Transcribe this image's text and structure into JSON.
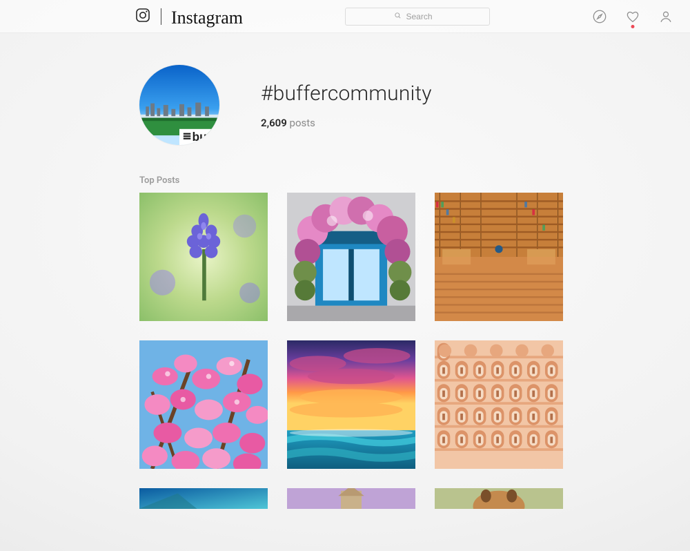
{
  "brand": {
    "name": "Instagram"
  },
  "search": {
    "placeholder": "Search"
  },
  "profile": {
    "hashtag": "#buffercommunity",
    "posts_count": "2,609",
    "posts_label": "posts"
  },
  "sections": {
    "top_posts": "Top Posts"
  },
  "nav_icons": {
    "explore": "compass-icon",
    "activity": "heart-icon",
    "profile": "user-icon"
  }
}
